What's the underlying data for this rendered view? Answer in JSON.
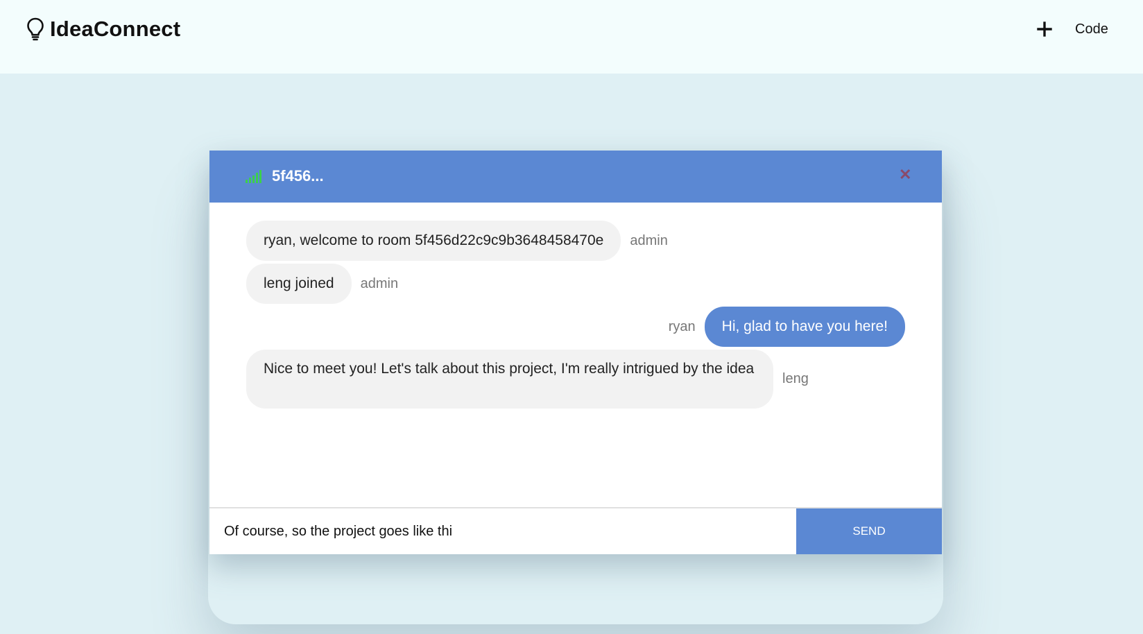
{
  "app": {
    "title": "IdeaConnect",
    "logo_icon": "lightbulb-icon"
  },
  "header_nav": {
    "add_icon": "plus-icon",
    "code_label": "Code"
  },
  "chat": {
    "room_title": "5f456...",
    "signal_icon": "signal-strength-icon",
    "signal_color": "#3ccf4e",
    "close_icon": "close-icon",
    "close_symbol": "✕",
    "accent_color": "#5b88d3",
    "messages": [
      {
        "text": "ryan, welcome to room 5f456d22c9c9b3648458470e",
        "sender": "admin",
        "mine": false
      },
      {
        "text": "leng joined",
        "sender": "admin",
        "mine": false
      },
      {
        "text": "Hi, glad to have you here!",
        "sender": "ryan",
        "mine": true
      },
      {
        "text": "Nice to meet you! Let's talk about this project, I'm really intrigued by the idea",
        "sender": "leng",
        "mine": false
      }
    ],
    "composer": {
      "value": "Of course, so the project goes like thi",
      "placeholder": ""
    },
    "send_label": "SEND"
  }
}
